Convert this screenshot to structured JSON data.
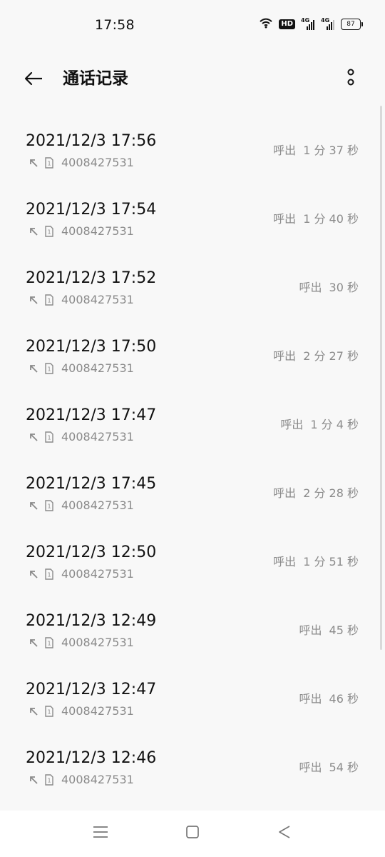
{
  "status_bar": {
    "time": "17:58",
    "hd_label": "HD",
    "network_label_1": "4G",
    "network_label_2": "4G",
    "battery_level": "87"
  },
  "header": {
    "title": "通话记录",
    "back_icon": "arrow-left-icon",
    "more_icon": "more-vertical-icon"
  },
  "call_list": {
    "items": [
      {
        "datetime": "2021/12/3 17:56",
        "number": "4008427531",
        "type": "呼出",
        "duration": "1 分 37 秒"
      },
      {
        "datetime": "2021/12/3 17:54",
        "number": "4008427531",
        "type": "呼出",
        "duration": "1 分 40 秒"
      },
      {
        "datetime": "2021/12/3 17:52",
        "number": "4008427531",
        "type": "呼出",
        "duration": "30 秒"
      },
      {
        "datetime": "2021/12/3 17:50",
        "number": "4008427531",
        "type": "呼出",
        "duration": "2 分 27 秒"
      },
      {
        "datetime": "2021/12/3 17:47",
        "number": "4008427531",
        "type": "呼出",
        "duration": "1 分 4 秒"
      },
      {
        "datetime": "2021/12/3 17:45",
        "number": "4008427531",
        "type": "呼出",
        "duration": "2 分 28 秒"
      },
      {
        "datetime": "2021/12/3 12:50",
        "number": "4008427531",
        "type": "呼出",
        "duration": "1 分 51 秒"
      },
      {
        "datetime": "2021/12/3 12:49",
        "number": "4008427531",
        "type": "呼出",
        "duration": "45 秒"
      },
      {
        "datetime": "2021/12/3 12:47",
        "number": "4008427531",
        "type": "呼出",
        "duration": "46 秒"
      },
      {
        "datetime": "2021/12/3 12:46",
        "number": "4008427531",
        "type": "呼出",
        "duration": "54 秒"
      }
    ]
  },
  "bottom_nav": {
    "menu_icon": "menu-icon",
    "home_icon": "home-square-icon",
    "back_icon": "back-triangle-icon"
  },
  "colors": {
    "background": "#f8f8f8",
    "primary_text": "#111111",
    "secondary_text": "#8a8a8a",
    "nav_background": "#ffffff"
  }
}
